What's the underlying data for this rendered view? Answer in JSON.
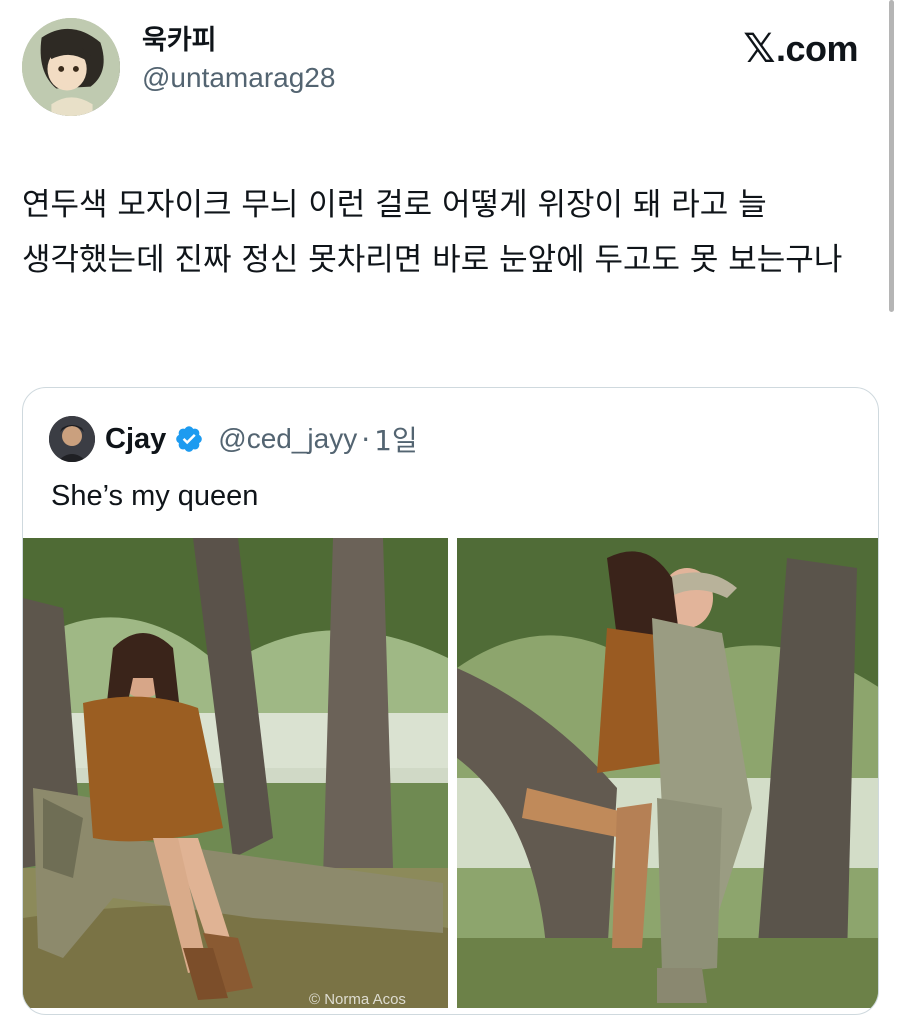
{
  "tweet": {
    "author_name": "욱카피",
    "author_handle": "@untamarag28",
    "text": "연두색 모자이크 무늬 이런 걸로 어떻게 위장이 돼 라고 늘 생각했는데 진짜 정신 못차리면 바로 눈앞에 두고도 못 보는구나"
  },
  "brand": {
    "logo_text": ".com",
    "logo_icon": "x-logo-icon"
  },
  "quoted_tweet": {
    "author_name": "Cjay",
    "author_handle": "@ced_jayy",
    "separator": "·",
    "time": "1일",
    "text": "She’s my queen",
    "verified_icon": "verified-badge-icon",
    "images": [
      {
        "description_icon": "photo",
        "watermark": "© Norma Acos"
      },
      {
        "description_icon": "photo"
      }
    ]
  },
  "colors": {
    "text_primary": "#0f1419",
    "text_secondary": "#536471",
    "verified_blue": "#1d9bf0",
    "border": "#cfd9de"
  }
}
